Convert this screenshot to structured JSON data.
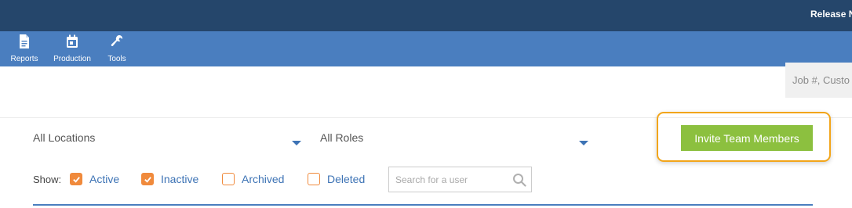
{
  "header": {
    "release_link": "Release N"
  },
  "nav": {
    "items": [
      {
        "label": "Reports",
        "icon": "document-icon"
      },
      {
        "label": "Production",
        "icon": "calendar-icon"
      },
      {
        "label": "Tools",
        "icon": "wrench-icon"
      }
    ],
    "search_placeholder": "Job #, Custo"
  },
  "filters": {
    "location_select": "All Locations",
    "role_select": "All Roles",
    "show_label": "Show:",
    "options": [
      {
        "label": "Active",
        "checked": true
      },
      {
        "label": "Inactive",
        "checked": true
      },
      {
        "label": "Archived",
        "checked": false
      },
      {
        "label": "Deleted",
        "checked": false
      }
    ],
    "user_search_placeholder": "Search for a user"
  },
  "actions": {
    "invite_label": "Invite Team Members"
  },
  "colors": {
    "topbar": "#25466b",
    "navbar": "#4a7ebf",
    "accent_green": "#8cc03f",
    "highlight_orange": "#f2a51a",
    "checkbox_orange": "#f08a3c",
    "link_blue": "#3d73b5"
  }
}
